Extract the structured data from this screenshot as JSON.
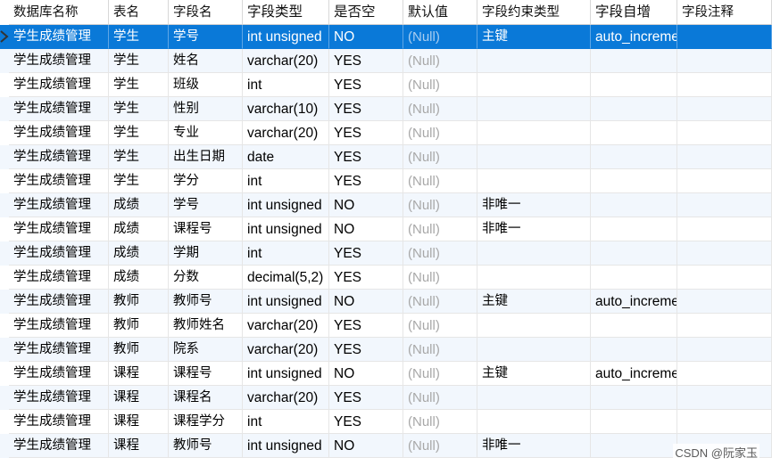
{
  "columns": [
    "数据库名称",
    "表名",
    "字段名",
    "字段类型",
    "是否空",
    "默认值",
    "字段约束类型",
    "字段自增",
    "字段注释"
  ],
  "rows": [
    [
      "学生成绩管理",
      "学生",
      "学号",
      "int unsigned",
      "NO",
      "(Null)",
      "主键",
      "auto_increme",
      ""
    ],
    [
      "学生成绩管理",
      "学生",
      "姓名",
      "varchar(20)",
      "YES",
      "(Null)",
      "",
      "",
      ""
    ],
    [
      "学生成绩管理",
      "学生",
      "班级",
      "int",
      "YES",
      "(Null)",
      "",
      "",
      ""
    ],
    [
      "学生成绩管理",
      "学生",
      "性别",
      "varchar(10)",
      "YES",
      "(Null)",
      "",
      "",
      ""
    ],
    [
      "学生成绩管理",
      "学生",
      "专业",
      "varchar(20)",
      "YES",
      "(Null)",
      "",
      "",
      ""
    ],
    [
      "学生成绩管理",
      "学生",
      "出生日期",
      "date",
      "YES",
      "(Null)",
      "",
      "",
      ""
    ],
    [
      "学生成绩管理",
      "学生",
      "学分",
      "int",
      "YES",
      "(Null)",
      "",
      "",
      ""
    ],
    [
      "学生成绩管理",
      "成绩",
      "学号",
      "int unsigned",
      "NO",
      "(Null)",
      "非唯一",
      "",
      ""
    ],
    [
      "学生成绩管理",
      "成绩",
      "课程号",
      "int unsigned",
      "NO",
      "(Null)",
      "非唯一",
      "",
      ""
    ],
    [
      "学生成绩管理",
      "成绩",
      "学期",
      "int",
      "YES",
      "(Null)",
      "",
      "",
      ""
    ],
    [
      "学生成绩管理",
      "成绩",
      "分数",
      "decimal(5,2)",
      "YES",
      "(Null)",
      "",
      "",
      ""
    ],
    [
      "学生成绩管理",
      "教师",
      "教师号",
      "int unsigned",
      "NO",
      "(Null)",
      "主键",
      "auto_increme",
      ""
    ],
    [
      "学生成绩管理",
      "教师",
      "教师姓名",
      "varchar(20)",
      "YES",
      "(Null)",
      "",
      "",
      ""
    ],
    [
      "学生成绩管理",
      "教师",
      "院系",
      "varchar(20)",
      "YES",
      "(Null)",
      "",
      "",
      ""
    ],
    [
      "学生成绩管理",
      "课程",
      "课程号",
      "int unsigned",
      "NO",
      "(Null)",
      "主键",
      "auto_increme",
      ""
    ],
    [
      "学生成绩管理",
      "课程",
      "课程名",
      "varchar(20)",
      "YES",
      "(Null)",
      "",
      "",
      ""
    ],
    [
      "学生成绩管理",
      "课程",
      "课程学分",
      "int",
      "YES",
      "(Null)",
      "",
      "",
      ""
    ],
    [
      "学生成绩管理",
      "课程",
      "教师号",
      "int unsigned",
      "NO",
      "(Null)",
      "非唯一",
      "",
      ""
    ]
  ],
  "selected_row": 0,
  "watermark": "CSDN @阮家玉",
  "icons": {
    "row_indicator": "row-pointer-icon"
  },
  "colors": {
    "selection": "#0a79d8",
    "alt_row": "#f2f7fd",
    "null_text": "#a8a8a8"
  }
}
